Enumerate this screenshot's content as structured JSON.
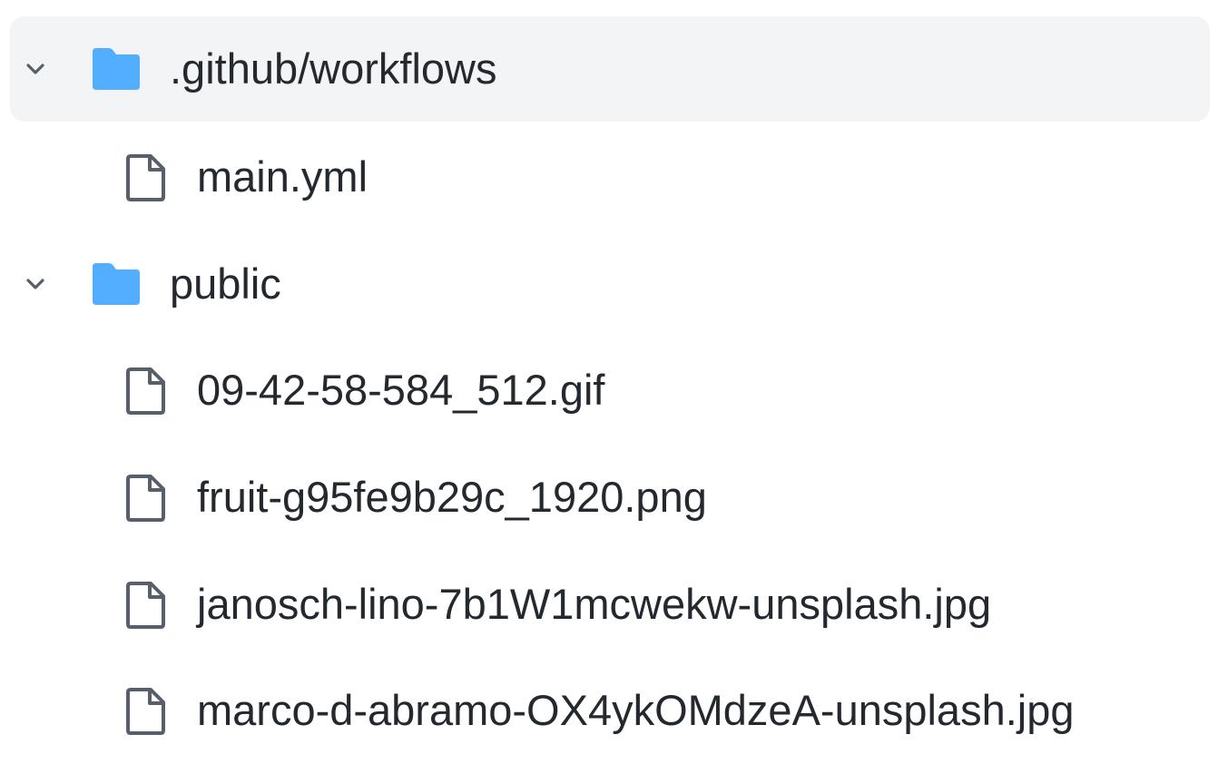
{
  "tree": {
    "items": [
      {
        "type": "folder",
        "name": ".github/workflows",
        "expanded": true,
        "selected": true
      },
      {
        "type": "file",
        "name": "main.yml"
      },
      {
        "type": "folder",
        "name": "public",
        "expanded": true,
        "selected": false
      },
      {
        "type": "file",
        "name": "09-42-58-584_512.gif"
      },
      {
        "type": "file",
        "name": "fruit-g95fe9b29c_1920.png"
      },
      {
        "type": "file",
        "name": "janosch-lino-7b1W1mcwekw-unsplash.jpg"
      },
      {
        "type": "file",
        "name": "marco-d-abramo-OX4ykOMdzeA-unsplash.jpg"
      }
    ]
  },
  "icons": {
    "chevron": "chevron-down-icon",
    "folder": "folder-icon",
    "file": "file-icon"
  },
  "colors": {
    "selected_row_bg": "#f3f4f6",
    "folder": "#54aeff",
    "icon_stroke": "#57606a",
    "text": "#24292f"
  }
}
